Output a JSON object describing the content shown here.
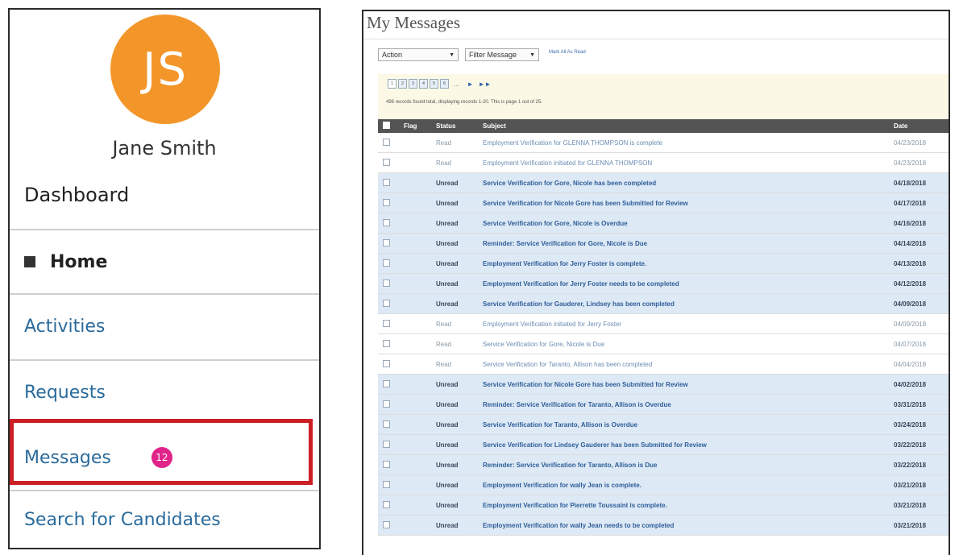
{
  "sidebar": {
    "avatar_initials": "JS",
    "user_name": "Jane Smith",
    "section_title": "Dashboard",
    "nav": {
      "home": "Home",
      "activities": "Activities",
      "requests": "Requests",
      "messages": "Messages",
      "messages_badge": "12",
      "search": "Search for Candidates"
    }
  },
  "messages_panel": {
    "title": "My Messages",
    "action_select": "Action",
    "filter_select": "Filter Message",
    "mark_all_read": "Mark All As Read",
    "pages": [
      "1",
      "2",
      "3",
      "4",
      "5",
      "6"
    ],
    "pager_ellipsis": "...",
    "pager_next": "►",
    "pager_last": "►►",
    "records_text": "496 records found total, displaying records 1-20. This is page 1 out of 25.",
    "columns": {
      "flag": "Flag",
      "status": "Status",
      "subject": "Subject",
      "date": "Date"
    },
    "rows": [
      {
        "status": "Read",
        "subject": "Employment Verification for GLENNA THOMPSON is complete",
        "date": "04/23/2018"
      },
      {
        "status": "Read",
        "subject": "Employment Verification initiated for GLENNA THOMPSON",
        "date": "04/23/2018"
      },
      {
        "status": "Unread",
        "subject": "Service Verification for Gore, Nicole has been completed",
        "date": "04/18/2018"
      },
      {
        "status": "Unread",
        "subject": "Service Verification for Nicole Gore has been Submitted for Review",
        "date": "04/17/2018"
      },
      {
        "status": "Unread",
        "subject": "Service Verification for Gore, Nicole is Overdue",
        "date": "04/16/2018"
      },
      {
        "status": "Unread",
        "subject": "Reminder: Service Verification for Gore, Nicole is Due",
        "date": "04/14/2018"
      },
      {
        "status": "Unread",
        "subject": "Employment Verification for Jerry Foster is complete.",
        "date": "04/13/2018"
      },
      {
        "status": "Unread",
        "subject": "Employment Verification for Jerry Foster needs to be completed",
        "date": "04/12/2018"
      },
      {
        "status": "Unread",
        "subject": "Service Verification for Gauderer, Lindsey has been completed",
        "date": "04/09/2018"
      },
      {
        "status": "Read",
        "subject": "Employment Verification initiated for Jerry Foster",
        "date": "04/09/2018"
      },
      {
        "status": "Read",
        "subject": "Service Verification for Gore, Nicole is Due",
        "date": "04/07/2018"
      },
      {
        "status": "Read",
        "subject": "Service Verification for Taranto, Allison has been completed",
        "date": "04/04/2018"
      },
      {
        "status": "Unread",
        "subject": "Service Verification for Nicole Gore has been Submitted for Review",
        "date": "04/02/2018"
      },
      {
        "status": "Unread",
        "subject": "Reminder: Service Verification for Taranto, Allison is Overdue",
        "date": "03/31/2018"
      },
      {
        "status": "Unread",
        "subject": "Service Verification for Taranto, Allison is Overdue",
        "date": "03/24/2018"
      },
      {
        "status": "Unread",
        "subject": "Service Verification for Lindsey Gauderer has been Submitted for Review",
        "date": "03/22/2018"
      },
      {
        "status": "Unread",
        "subject": "Reminder: Service Verification for Taranto, Allison is Due",
        "date": "03/22/2018"
      },
      {
        "status": "Unread",
        "subject": "Employment Verification for wally Jean is complete.",
        "date": "03/21/2018"
      },
      {
        "status": "Unread",
        "subject": "Employment Verification for Pierrette Toussaint is complete.",
        "date": "03/21/2018"
      },
      {
        "status": "Unread",
        "subject": "Employment Verification for wally Jean needs to be completed",
        "date": "03/21/2018"
      }
    ]
  }
}
